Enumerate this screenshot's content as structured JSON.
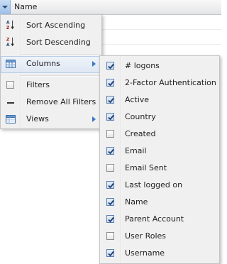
{
  "header": {
    "column_name": "Name"
  },
  "menu": {
    "sort_ascending": "Sort Ascending",
    "sort_descending": "Sort Descending",
    "columns": "Columns",
    "filters": "Filters",
    "remove_all_filters": "Remove All Filters",
    "views": "Views"
  },
  "sort_icon_letters": {
    "a": "A",
    "z": "Z"
  },
  "columns_submenu": [
    {
      "label": "# logons",
      "checked": true
    },
    {
      "label": "2-Factor Authentication",
      "checked": true
    },
    {
      "label": "Active",
      "checked": true
    },
    {
      "label": "Country",
      "checked": true
    },
    {
      "label": "Created",
      "checked": false
    },
    {
      "label": "Email",
      "checked": true
    },
    {
      "label": "Email Sent",
      "checked": false
    },
    {
      "label": "Last logged on",
      "checked": true
    },
    {
      "label": "Name",
      "checked": true
    },
    {
      "label": "Parent Account",
      "checked": true
    },
    {
      "label": "User Roles",
      "checked": false
    },
    {
      "label": "Username",
      "checked": true
    }
  ],
  "colors": {
    "accent": "#3a77c3",
    "menu_bg": "#f0f0f0",
    "highlight": "#dde7f3"
  }
}
